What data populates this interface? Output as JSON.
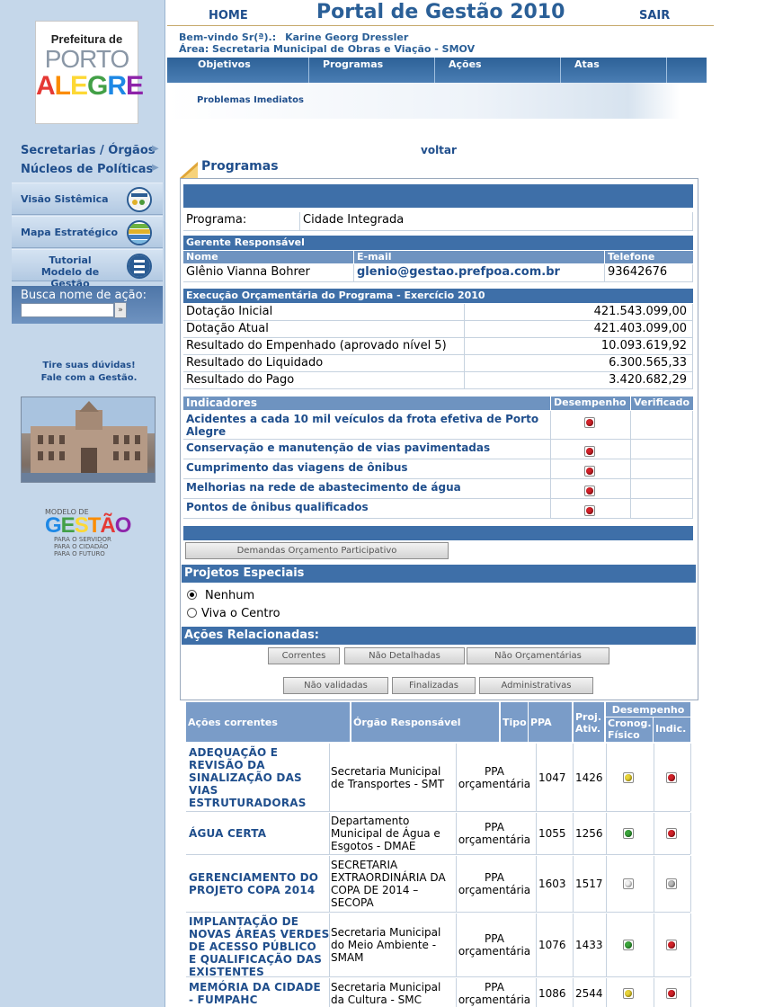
{
  "header": {
    "home": "HOME",
    "title": "Portal de Gestão 2010",
    "sair": "SAIR",
    "welcome_label": "Bem-vindo Sr(ª).:",
    "welcome_name": "Karine Georg Dressler",
    "area": "Área: Secretaria Municipal de Obras e Viação - SMOV"
  },
  "nav": {
    "tabs": [
      "Objetivos",
      "Programas",
      "Ações",
      "Atas"
    ],
    "sub": "Problemas Imediatos"
  },
  "sidebar": {
    "logo_line1": "Prefeitura de",
    "logo_line2": "PORTO",
    "logo_line3": [
      "A",
      "L",
      "E",
      "G",
      "R",
      "E"
    ],
    "link1": "Secretarias / Órgãos",
    "link2": "Núcleos de Políticas",
    "btn1": "Visão Sistêmica",
    "btn2": "Mapa Estratégico",
    "btn3_l1": "Tutorial",
    "btn3_l2": "Modelo de Gestão",
    "busca_label": "Busca nome de ação:",
    "busca_btn": "»",
    "duvidas_l1": "Tire suas dúvidas!",
    "duvidas_l2": "Fale com a Gestão.",
    "mg_top": "MODELO DE",
    "mg_word": [
      "G",
      "E",
      "S",
      "T",
      "Ã",
      "O"
    ],
    "mg_l1": "PARA O SERVIDOR",
    "mg_l2": "PARA O CIDADÃO",
    "mg_l3": "PARA O FUTURO"
  },
  "page": {
    "voltar": "voltar",
    "section_title": "Programas"
  },
  "programa": {
    "label": "Programa:",
    "value": "Cidade Integrada"
  },
  "gerente": {
    "title": "Gerente Responsável",
    "col_nome": "Nome",
    "col_email": "E-mail",
    "col_tel": "Telefone",
    "nome": "Glênio Vianna Bohrer",
    "email": "glenio@gestao.prefpoa.com.br",
    "telefone": "93642676"
  },
  "execucao": {
    "title": "Execução Orçamentária do Programa - Exercício 2010",
    "rows": [
      {
        "label": "Dotação Inicial",
        "value": "421.543.099,00"
      },
      {
        "label": "Dotação Atual",
        "value": "421.403.099,00"
      },
      {
        "label": "Resultado do Empenhado (aprovado nível 5)",
        "value": "10.093.619,92"
      },
      {
        "label": "Resultado do Liquidado",
        "value": "6.300.565,33"
      },
      {
        "label": "Resultado do Pago",
        "value": "3.420.682,29"
      }
    ]
  },
  "indicadores": {
    "col_ind": "Indicadores",
    "col_des": "Desempenho",
    "col_ver": "Verificado",
    "rows": [
      {
        "l1": "Acidentes a cada 10 mil veículos da frota efetiva de Porto",
        "l2": "Alegre",
        "status": "red"
      },
      {
        "l1": "Conservação e manutenção de vias pavimentadas",
        "l2": "",
        "status": "red"
      },
      {
        "l1": "Cumprimento das viagens de ônibus",
        "l2": "",
        "status": "red"
      },
      {
        "l1": "Melhorias na rede de abastecimento de água",
        "l2": "",
        "status": "red"
      },
      {
        "l1": "Pontos de ônibus qualificados",
        "l2": "",
        "status": "red"
      }
    ]
  },
  "demandas_btn": "Demandas Orçamento Participativo",
  "projetos": {
    "title": "Projetos Especiais",
    "options": [
      "Nenhum",
      "Viva o Centro"
    ],
    "selected": "Nenhum"
  },
  "acoes_rel": {
    "title": "Ações Relacionadas:",
    "buttons_row1": [
      "Correntes",
      "Não Detalhadas",
      "Não Orçamentárias"
    ],
    "buttons_row2": [
      "Não validadas",
      "Finalizadas",
      "Administrativas"
    ]
  },
  "acoes_table": {
    "headers": {
      "acoes": "Ações correntes",
      "orgao": "Órgão Responsável",
      "tipo": "Tipo",
      "ppa": "PPA",
      "proj": [
        "Proj.",
        "Ativ."
      ],
      "desempenho": "Desempenho",
      "cronog": [
        "Cronog.",
        "Físico"
      ],
      "indic": "Indic."
    },
    "rows": [
      {
        "name": [
          "ADEQUAÇÃO E",
          "REVISÃO DA",
          "SINALIZAÇÃO DAS",
          "VIAS",
          "ESTRUTURADORAS"
        ],
        "orgao": [
          "Secretaria Municipal",
          "de Transportes - SMT"
        ],
        "tipo": [
          "PPA",
          "orçamentária"
        ],
        "ppa": "1047",
        "proj": "1426",
        "cronog": "yellow",
        "indic": "red"
      },
      {
        "name": [
          "ÁGUA CERTA"
        ],
        "orgao": [
          "Departamento",
          "Municipal de Água e",
          "Esgotos - DMAE"
        ],
        "tipo": [
          "PPA",
          "orçamentária"
        ],
        "ppa": "1055",
        "proj": "1256",
        "cronog": "green",
        "indic": "red"
      },
      {
        "name": [
          "GERENCIAMENTO DO",
          "PROJETO COPA 2014"
        ],
        "orgao": [
          "SECRETARIA",
          "EXTRAORDINÁRIA DA",
          "COPA DE 2014 –",
          "SECOPA"
        ],
        "tipo": [
          "PPA",
          "orçamentária"
        ],
        "ppa": "1603",
        "proj": "1517",
        "cronog": "white",
        "indic": "gray"
      },
      {
        "name": [
          "IMPLANTAÇÃO DE",
          "NOVAS ÁREAS VERDES",
          "DE ACESSO PÚBLICO",
          "E QUALIFICAÇÃO DAS",
          "EXISTENTES"
        ],
        "orgao": [
          "Secretaria Municipal",
          "do Meio Ambiente -",
          "SMAM"
        ],
        "tipo": [
          "PPA",
          "orçamentária"
        ],
        "ppa": "1076",
        "proj": "1433",
        "cronog": "green",
        "indic": "red"
      },
      {
        "name": [
          "MEMÓRIA DA CIDADE",
          "- FUMPAHC"
        ],
        "orgao": [
          "Secretaria Municipal",
          "da Cultura - SMC"
        ],
        "tipo": [
          "PPA",
          "orçamentária"
        ],
        "ppa": "1086",
        "proj": "2544",
        "cronog": "yellow",
        "indic": "red"
      }
    ]
  }
}
